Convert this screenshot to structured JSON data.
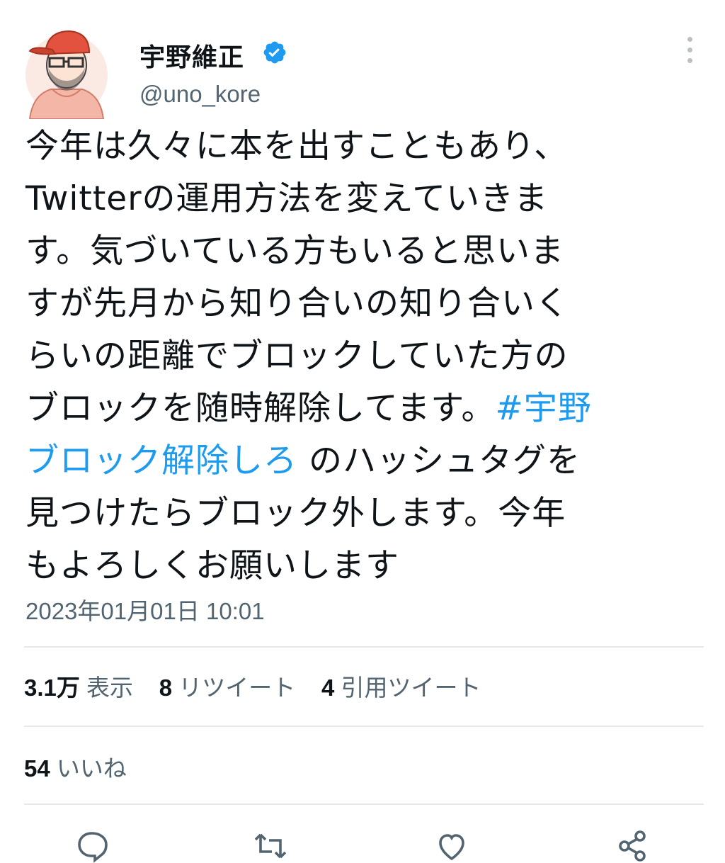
{
  "author": {
    "display_name": "宇野維正",
    "handle": "@uno_kore",
    "verified": true
  },
  "tweet": {
    "lines": [
      [
        {
          "text": "今年は久々に本を出すこともあり、"
        }
      ],
      [
        {
          "text": "Twitterの運用方法を変えていきま"
        }
      ],
      [
        {
          "text": "す。気づいている方もいると思いま"
        }
      ],
      [
        {
          "text": "すが先月から知り合いの知り合いく"
        }
      ],
      [
        {
          "text": "らいの距離でブロックしていた方の"
        }
      ],
      [
        {
          "text": "ブロックを随時解除してます。"
        },
        {
          "text": "#宇野",
          "tag": true
        }
      ],
      [
        {
          "text": "ブロック解除しろ",
          "tag": true
        },
        {
          "text": " のハッシュタグを"
        }
      ],
      [
        {
          "text": "見つけたらブロック外します。今年"
        }
      ],
      [
        {
          "text": "もよろしくお願いします"
        }
      ]
    ],
    "timestamp": "2023年01月01日 10:01"
  },
  "stats": {
    "views_count": "3.1万",
    "views_label": "表示",
    "retweets_count": "8",
    "retweets_label": "リツイート",
    "quotes_count": "4",
    "quotes_label": "引用ツイート",
    "likes_count": "54",
    "likes_label": "いいね"
  },
  "icons": {
    "verified": "verified-badge-icon",
    "more": "more-vertical-icon",
    "reply": "reply-icon",
    "retweet": "retweet-icon",
    "like": "heart-icon",
    "share": "share-icon"
  },
  "colors": {
    "hashtag": "#1d9bf0",
    "verified": "#1d9bf0",
    "secondary_text": "#536471"
  }
}
